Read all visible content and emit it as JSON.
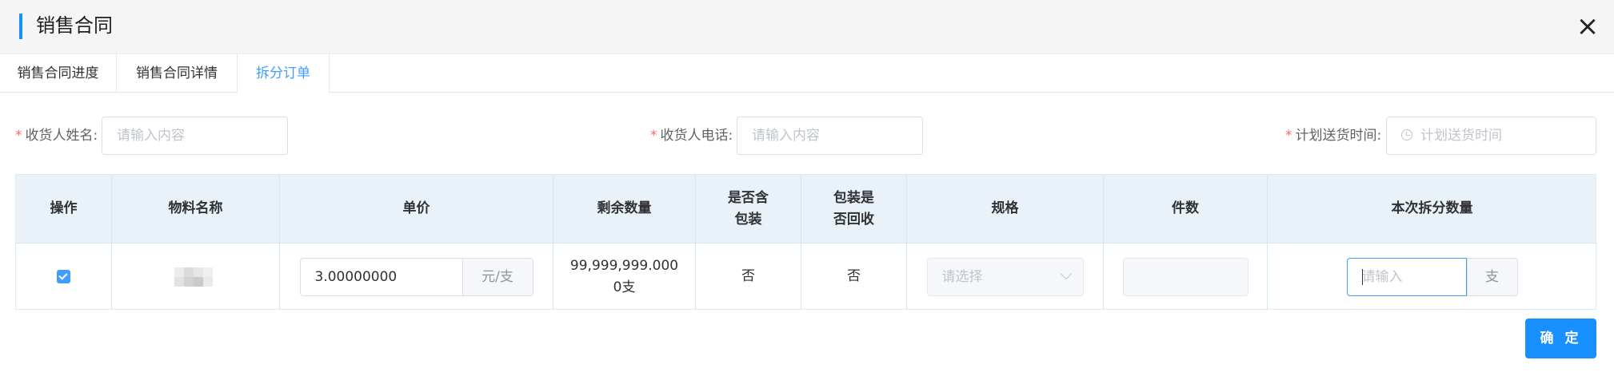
{
  "dialog": {
    "title": "销售合同",
    "close_glyph": "×"
  },
  "tabs": [
    {
      "label": "销售合同进度",
      "active": false
    },
    {
      "label": "销售合同详情",
      "active": false
    },
    {
      "label": "拆分订单",
      "active": true
    }
  ],
  "form": {
    "required_mark": "*",
    "receiver_name": {
      "label": "收货人姓名:",
      "placeholder": "请输入内容"
    },
    "receiver_phone": {
      "label": "收货人电话:",
      "placeholder": "请输入内容"
    },
    "delivery_time": {
      "label": "计划送货时间:",
      "placeholder": "计划送货时间",
      "icon": "clock-icon"
    }
  },
  "table": {
    "headers": [
      "操作",
      "物料名称",
      "单价",
      "剩余数量",
      "是否含包装",
      "包装是否回收",
      "规格",
      "件数",
      "本次拆分数量"
    ],
    "header_lines": {
      "has_packaging": [
        "是否含",
        "包装"
      ],
      "packaging_recycled": [
        "包装是",
        "否回收"
      ]
    },
    "rows": [
      {
        "checked": true,
        "material_name": "",
        "unit_price": "3.00000000",
        "unit_price_unit": "元/支",
        "remaining_qty_lines": [
          "99,999,999.000",
          "0支"
        ],
        "has_packaging": "否",
        "packaging_recycled": "否",
        "spec_placeholder": "请选择",
        "pieces": "",
        "split_qty_placeholder": "请输入",
        "split_qty_unit": "支"
      }
    ]
  },
  "footer": {
    "confirm_label": "确 定"
  },
  "colors": {
    "accent": "#1890ff",
    "active_tab": "#409eff",
    "required": "#f56c6c",
    "header_bg": "#e9f2f8"
  }
}
